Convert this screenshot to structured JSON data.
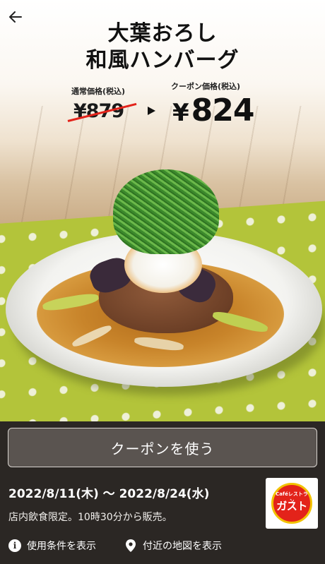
{
  "header": {
    "back_icon": "arrow-left-icon"
  },
  "product": {
    "title_line1": "大葉おろし",
    "title_line2": "和風ハンバーグ",
    "regular_label": "通常価格(税込)",
    "regular_price": "¥879",
    "coupon_label": "クーポン価格(税込)",
    "coupon_yen": "¥",
    "coupon_price": "824"
  },
  "coupon": {
    "use_button": "クーポンを使う",
    "period": "2022/8/11(木) 〜 2022/8/24(水)",
    "note": "店内飲食限定。10時30分から販売。"
  },
  "brand": {
    "logo_small": "Caféレストラン",
    "logo_main": "ガスト",
    "colors": {
      "red": "#e3231a",
      "yellow": "#f2c200"
    }
  },
  "links": {
    "conditions": "使用条件を表示",
    "conditions_icon": "info-icon",
    "map": "付近の地図を表示",
    "map_icon": "map-pin-icon"
  }
}
